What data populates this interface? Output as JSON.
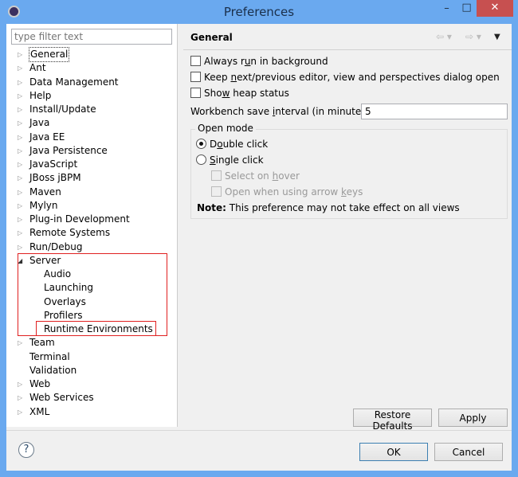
{
  "window": {
    "title": "Preferences",
    "minimize": "–",
    "maximize": "□",
    "close": "✕"
  },
  "filter": {
    "placeholder": "type filter text"
  },
  "tree": [
    {
      "label": "General",
      "selected": true,
      "expanded": false
    },
    {
      "label": "Ant"
    },
    {
      "label": "Data Management"
    },
    {
      "label": "Help"
    },
    {
      "label": "Install/Update"
    },
    {
      "label": "Java"
    },
    {
      "label": "Java EE"
    },
    {
      "label": "Java Persistence"
    },
    {
      "label": "JavaScript"
    },
    {
      "label": "JBoss jBPM"
    },
    {
      "label": "Maven"
    },
    {
      "label": "Mylyn"
    },
    {
      "label": "Plug-in Development"
    },
    {
      "label": "Remote Systems"
    },
    {
      "label": "Run/Debug"
    },
    {
      "label": "Server",
      "expanded": true,
      "children": [
        "Audio",
        "Launching",
        "Overlays",
        "Profilers",
        "Runtime Environments"
      ]
    },
    {
      "label": "Team"
    },
    {
      "label": "Terminal",
      "leaf": true
    },
    {
      "label": "Validation",
      "leaf": true
    },
    {
      "label": "Web"
    },
    {
      "label": "Web Services"
    },
    {
      "label": "XML"
    }
  ],
  "page": {
    "title": "General",
    "options": [
      {
        "pre": "Always r",
        "u": "u",
        "post": "n in background",
        "checked": false
      },
      {
        "pre": "Keep ",
        "u": "n",
        "post": "ext/previous editor, view and perspectives dialog open",
        "checked": false
      },
      {
        "pre": "Sho",
        "u": "w",
        "post": " heap status",
        "checked": false
      }
    ],
    "save_interval": {
      "pre": "Workbench save ",
      "u": "i",
      "post": "nterval (in minutes):",
      "value": "5"
    },
    "open_mode": {
      "label": "Open mode",
      "double_click": {
        "pre": "D",
        "u": "o",
        "post": "uble click",
        "selected": true
      },
      "single_click": {
        "pre": "",
        "u": "S",
        "post": "ingle click",
        "selected": false
      },
      "select_on_hover": {
        "pre": "Select on ",
        "u": "h",
        "post": "over"
      },
      "open_arrow_keys": {
        "pre": "Open when using arrow ",
        "u": "k",
        "post": "eys"
      },
      "note_bold": "Note:",
      "note": " This preference may not take effect on all views"
    },
    "restore_defaults": "Restore Defaults",
    "apply": "Apply"
  },
  "footer": {
    "help": "?",
    "ok": "OK",
    "cancel": "Cancel"
  },
  "colors": {
    "titlebar": "#6aa9ef",
    "close": "#c75050",
    "highlight": "#e02020"
  }
}
